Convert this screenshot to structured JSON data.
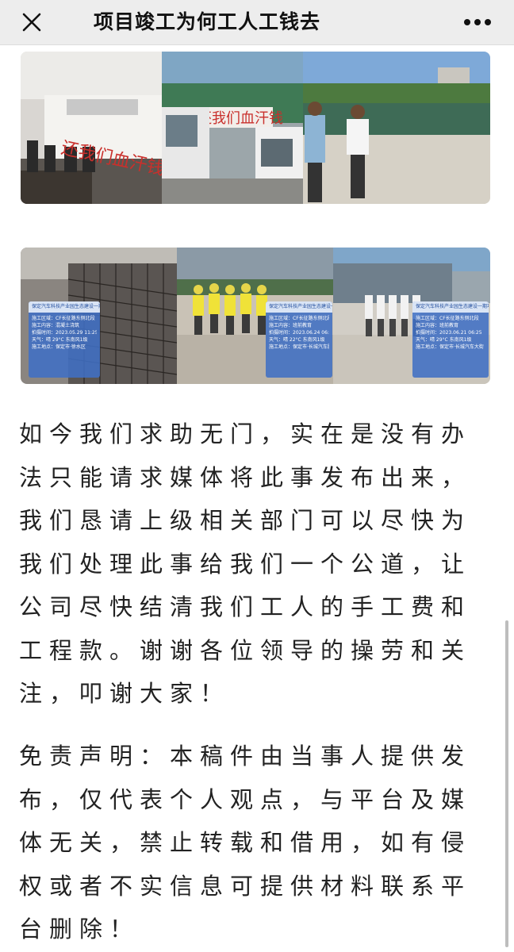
{
  "header": {
    "title": "项目竣工为何工人工钱去",
    "close_icon": "close-icon",
    "more_icon": "more-dots-icon",
    "background": "#ededed"
  },
  "photos_row1": [
    {
      "caption": "office-protest-banner-photo",
      "banner_text": "还我们血汗钱"
    },
    {
      "caption": "van-protest-banner-photo",
      "banner_text": "还我们血汗钱"
    },
    {
      "caption": "site-workers-photo"
    }
  ],
  "photos_row2": [
    {
      "caption": "rebar-site-photo",
      "watermark": {
        "head": "保定汽车科技产业园生态建设一期项目设计、施工总承包",
        "lines": [
          "施工区域：CF长征路东侧北段",
          "施工内容：混凝土浇筑",
          "拍摄时间：2023.05.29 11:25",
          "天气：晴 29°C 东南风1级",
          "施工地点：保定市·徐水区"
        ]
      }
    },
    {
      "caption": "workers-group-photo",
      "watermark": {
        "head": "保定汽车科技产业园生态建设一期项目设计、施工总承包",
        "lines": [
          "施工区域：CF长征路东侧北段",
          "施工内容：班前教育",
          "拍摄时间：2023.06.24 06:25",
          "天气：晴 22°C 东南风1级",
          "施工地点：保定市·长城汽车股份有限公司"
        ]
      }
    },
    {
      "caption": "stadium-workers-photo",
      "watermark": {
        "head": "保定汽车科技产业园生态建设一期项目设计、施工总承包",
        "lines": [
          "施工区域：CF长征路东侧北段",
          "施工内容：班前教育",
          "拍摄时间：2023.06.21 06:25",
          "天气：晴 29°C 东南风1级",
          "施工地点：保定市·长城汽车大街"
        ]
      }
    }
  ],
  "article": {
    "paragraph1": "如今我们求助无门，实在是没有办法只能请求媒体将此事发布出来，我们恳请上级相关部门可以尽快为我们处理此事给我们一个公道，让公司尽快结清我们工人的手工费和工程款。谢谢各位领导的操劳和关注，叩谢大家！",
    "paragraph2": "免责声明：本稿件由当事人提供发布，仅代表个人观点，与平台及媒体无关，禁止转载和借用，如有侵权或者不实信息可提供材料联系平台删除！"
  },
  "colors": {
    "banner_red": "#c9302c",
    "watermark_blue": "#4070c4",
    "text": "#222222"
  }
}
